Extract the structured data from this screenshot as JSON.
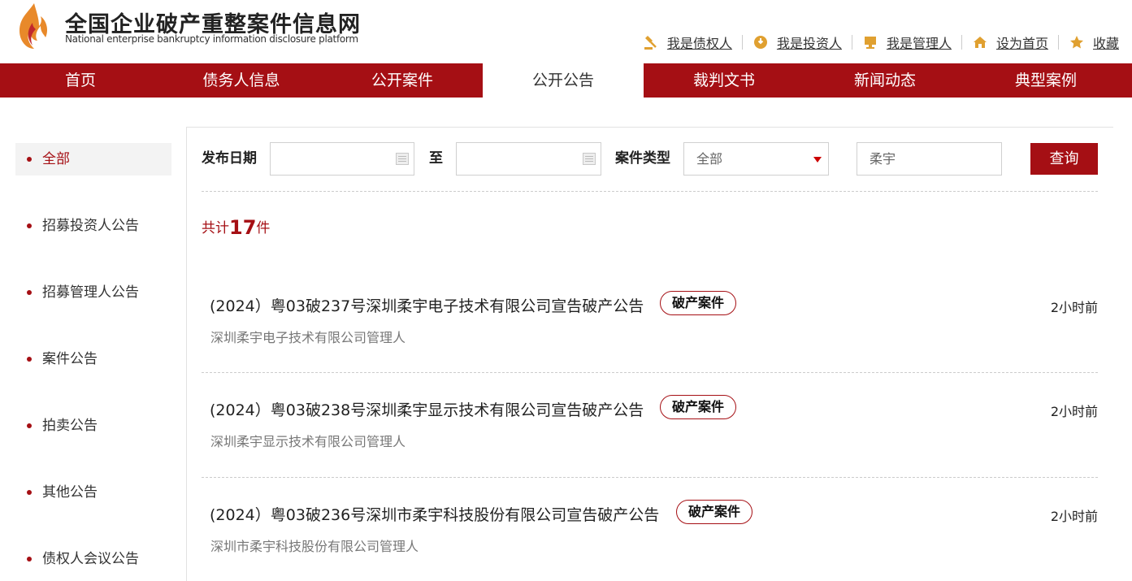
{
  "site": {
    "title": "全国企业破产重整案件信息网",
    "subtitle": "National enterprise bankruptcy  information disclosure platform"
  },
  "top_links": [
    {
      "label": "我是债权人",
      "icon": "creditor-icon"
    },
    {
      "label": "我是投资人",
      "icon": "investor-icon"
    },
    {
      "label": "我是管理人",
      "icon": "manager-icon"
    },
    {
      "label": "设为首页",
      "icon": "home-icon"
    },
    {
      "label": "收藏",
      "icon": "star-icon"
    }
  ],
  "nav": [
    "首页",
    "债务人信息",
    "公开案件",
    "公开公告",
    "裁判文书",
    "新闻动态",
    "典型案例"
  ],
  "nav_active": "公开公告",
  "sidebar": [
    "全部",
    "招募投资人公告",
    "招募管理人公告",
    "案件公告",
    "拍卖公告",
    "其他公告",
    "债权人会议公告"
  ],
  "sidebar_active": "全部",
  "filter": {
    "date_label": "发布日期",
    "to_label": "至",
    "date_from": "",
    "date_to": "",
    "type_label": "案件类型",
    "type_value": "全部",
    "keyword": "柔宇",
    "query_label": "查询"
  },
  "total": {
    "prefix": "共计",
    "count": "17",
    "suffix": "件"
  },
  "results": [
    {
      "title": "(2024）粤03破237号深圳柔宇电子技术有限公司宣告破产公告",
      "badge": "破产案件",
      "time": "2小时前",
      "sub": "深圳柔宇电子技术有限公司管理人"
    },
    {
      "title": "(2024）粤03破238号深圳柔宇显示技术有限公司宣告破产公告",
      "badge": "破产案件",
      "time": "2小时前",
      "sub": "深圳柔宇显示技术有限公司管理人"
    },
    {
      "title": "(2024）粤03破236号深圳市柔宇科技股份有限公司宣告破产公告",
      "badge": "破产案件",
      "time": "2小时前",
      "sub": "深圳市柔宇科技股份有限公司管理人"
    }
  ],
  "colors": {
    "brand_red": "#a50f14",
    "flame_orange": "#e8892a"
  }
}
